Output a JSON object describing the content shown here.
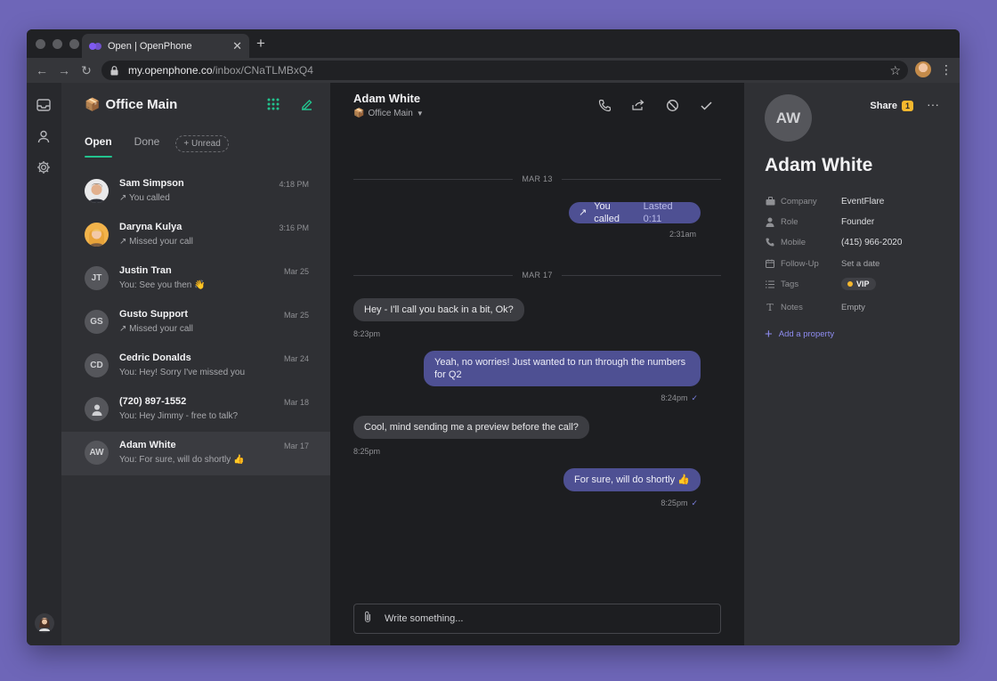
{
  "browser": {
    "tab_title": "Open | OpenPhone",
    "url_host": "my.openphone.co",
    "url_path": "/inbox/CNaTLMBxQ4"
  },
  "inbox": {
    "emoji": "📦",
    "name": "Office Main",
    "filters": {
      "open": "Open",
      "done": "Done",
      "unread": "+ Unread"
    }
  },
  "conversations": [
    {
      "name": "Sam Simpson",
      "preview": "You called",
      "time": "4:18 PM",
      "avatar": "photo-sam",
      "icon": "outgoing"
    },
    {
      "name": "Daryna Kulya",
      "preview": "Missed your call",
      "time": "3:16 PM",
      "avatar": "photo-daryna",
      "icon": "outgoing"
    },
    {
      "name": "Justin Tran",
      "preview": "You: See you then 👋",
      "time": "Mar 25",
      "avatar": "JT"
    },
    {
      "name": "Gusto Support",
      "preview": "Missed your call",
      "time": "Mar 25",
      "avatar": "GS",
      "icon": "outgoing"
    },
    {
      "name": "Cedric Donalds",
      "preview": "You: Hey! Sorry I've missed you",
      "time": "Mar 24",
      "avatar": "CD"
    },
    {
      "name": "(720) 897-1552",
      "preview": "You: Hey Jimmy - free to talk?",
      "time": "Mar 18",
      "avatar": "person-icon"
    },
    {
      "name": "Adam White",
      "preview": "You: For sure, will do shortly 👍",
      "time": "Mar 17",
      "avatar": "AW",
      "selected": true
    }
  ],
  "chat": {
    "contact_name": "Adam White",
    "inbox_label": "Office Main",
    "day1": "MAR 13",
    "call_label": "You called",
    "call_duration": "Lasted 0:11",
    "call_time": "2:31am",
    "day2": "MAR 17",
    "messages": [
      {
        "dir": "in",
        "text": "Hey - I'll call you back in a bit, Ok?",
        "time": "8:23pm"
      },
      {
        "dir": "out",
        "text": "Yeah, no worries! Just wanted to run through the numbers for Q2",
        "time": "8:24pm"
      },
      {
        "dir": "in",
        "text": "Cool, mind sending me a preview before the call?",
        "time": "8:25pm"
      },
      {
        "dir": "out",
        "text": "For sure, will do shortly 👍",
        "time": "8:25pm"
      }
    ],
    "composer_placeholder": "Write something..."
  },
  "contact": {
    "initials": "AW",
    "name": "Adam White",
    "share_label": "Share",
    "share_count": "1",
    "properties": [
      {
        "label": "Company",
        "value": "EventFlare",
        "icon": "company-icon"
      },
      {
        "label": "Role",
        "value": "Founder",
        "icon": "role-icon"
      },
      {
        "label": "Mobile",
        "value": "(415) 966-2020",
        "icon": "phone-icon"
      },
      {
        "label": "Follow-Up",
        "value": "Set a date",
        "icon": "calendar-icon",
        "muted": true
      },
      {
        "label": "Tags",
        "value": "VIP",
        "icon": "tags-icon",
        "tag": true
      },
      {
        "label": "Notes",
        "value": "Empty",
        "icon": "notes-icon",
        "muted": true
      }
    ],
    "add_property": "Add a property"
  },
  "colors": {
    "accent_green": "#22c38e",
    "outgoing_bubble": "#4e5093",
    "link_purple": "#8e8cf0",
    "badge_yellow": "#f5b82e"
  }
}
